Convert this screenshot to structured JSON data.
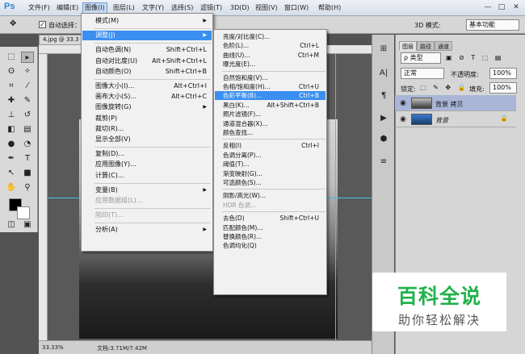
{
  "app": {
    "logo": "Ps"
  },
  "menubar": {
    "items": [
      "文件(F)",
      "编辑(E)",
      "图像(I)",
      "图层(L)",
      "文字(Y)",
      "选择(S)",
      "滤镜(T)",
      "3D(D)",
      "视图(V)",
      "窗口(W)",
      "帮助(H)"
    ],
    "active": "图像(I)"
  },
  "window_controls": {
    "minimize": "—",
    "restore": "□",
    "close": "✕"
  },
  "options_bar": {
    "auto_select": "自动选择：",
    "mode_3d": "3D 模式:",
    "workspace": "基本功能"
  },
  "document": {
    "tab": "4.jpg @ 33.3",
    "zoom": "33.33%",
    "status": "文档:3.71M/7.42M"
  },
  "image_menu": {
    "items": [
      {
        "label": "模式(M)",
        "submenu": true
      },
      {
        "sep": true
      },
      {
        "label": "调整(J)",
        "submenu": true,
        "highlight": true
      },
      {
        "sep": true
      },
      {
        "label": "自动色调(N)",
        "shortcut": "Shift+Ctrl+L"
      },
      {
        "label": "自动对比度(U)",
        "shortcut": "Alt+Shift+Ctrl+L"
      },
      {
        "label": "自动颜色(O)",
        "shortcut": "Shift+Ctrl+B"
      },
      {
        "sep": true
      },
      {
        "label": "图像大小(I)...",
        "shortcut": "Alt+Ctrl+I"
      },
      {
        "label": "画布大小(S)...",
        "shortcut": "Alt+Ctrl+C"
      },
      {
        "label": "图像旋转(G)",
        "submenu": true
      },
      {
        "label": "裁剪(P)"
      },
      {
        "label": "裁切(R)..."
      },
      {
        "label": "显示全部(V)"
      },
      {
        "sep": true
      },
      {
        "label": "复制(D)..."
      },
      {
        "label": "应用图像(Y)..."
      },
      {
        "label": "计算(C)..."
      },
      {
        "sep": true
      },
      {
        "label": "变量(B)",
        "submenu": true
      },
      {
        "label": "应用数据组(L)...",
        "disabled": true
      },
      {
        "sep": true
      },
      {
        "label": "陷印(T)...",
        "disabled": true
      },
      {
        "sep": true
      },
      {
        "label": "分析(A)",
        "submenu": true
      }
    ]
  },
  "adjust_menu": {
    "items": [
      {
        "label": "亮度/对比度(C)..."
      },
      {
        "label": "色阶(L)...",
        "shortcut": "Ctrl+L"
      },
      {
        "label": "曲线(U)...",
        "shortcut": "Ctrl+M"
      },
      {
        "label": "曝光度(E)..."
      },
      {
        "sep": true
      },
      {
        "label": "自然饱和度(V)..."
      },
      {
        "label": "色相/饱和度(H)...",
        "shortcut": "Ctrl+U"
      },
      {
        "label": "色彩平衡(B)...",
        "shortcut": "Ctrl+B",
        "highlight": true
      },
      {
        "label": "黑白(K)...",
        "shortcut": "Alt+Shift+Ctrl+B"
      },
      {
        "label": "照片滤镜(F)..."
      },
      {
        "label": "通道混合器(X)..."
      },
      {
        "label": "颜色查找..."
      },
      {
        "sep": true
      },
      {
        "label": "反相(I)",
        "shortcut": "Ctrl+I"
      },
      {
        "label": "色调分离(P)..."
      },
      {
        "label": "阈值(T)..."
      },
      {
        "label": "渐变映射(G)..."
      },
      {
        "label": "可选颜色(S)..."
      },
      {
        "sep": true
      },
      {
        "label": "阴影/高光(W)..."
      },
      {
        "label": "HDR 色调...",
        "disabled": true
      },
      {
        "sep": true
      },
      {
        "label": "去色(D)",
        "shortcut": "Shift+Ctrl+U"
      },
      {
        "label": "匹配颜色(M)..."
      },
      {
        "label": "替换颜色(R)..."
      },
      {
        "label": "色调均化(Q)"
      }
    ]
  },
  "layers_panel": {
    "tabs": [
      "图层",
      "路径",
      "通道"
    ],
    "kind": "ρ 类型",
    "blend": "正常",
    "opacity_label": "不透明度:",
    "opacity": "100%",
    "lock_label": "锁定:",
    "fill_label": "填充:",
    "fill": "100%",
    "layers": [
      {
        "name": "背景 拷贝"
      },
      {
        "name": "背景"
      }
    ]
  },
  "watermark": {
    "title": "百科全说",
    "subtitle": "助你轻松解决"
  },
  "colors": {
    "highlight": "#3b8ff0",
    "brand": "#22b14c",
    "guide": "#3fc6e0"
  }
}
